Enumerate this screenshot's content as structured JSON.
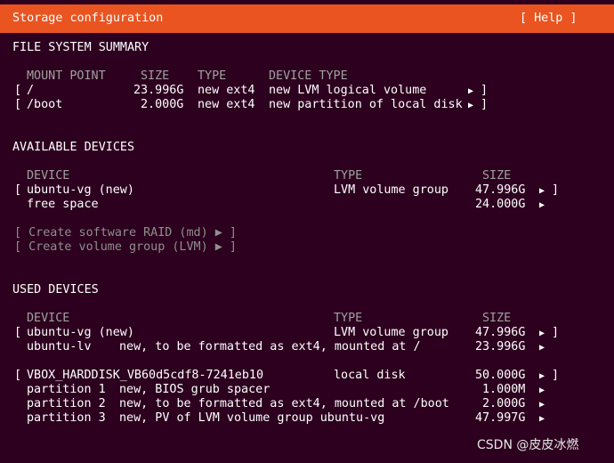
{
  "header": {
    "title": "Storage configuration",
    "help_button": "[ Help ]"
  },
  "fs_summary": {
    "heading": "FILE SYSTEM SUMMARY",
    "columns": [
      "MOUNT POINT",
      "SIZE",
      "TYPE",
      "DEVICE TYPE"
    ],
    "rows": [
      {
        "bracket_open": "[",
        "mount": "/",
        "size": "23.996G",
        "type": "new ext4",
        "device_type": "new LVM logical volume",
        "arrow": "▶",
        "bracket_close": "]"
      },
      {
        "bracket_open": "[",
        "mount": "/boot",
        "size": "2.000G",
        "type": "new ext4",
        "device_type": "new partition of local disk",
        "arrow": "▶",
        "bracket_close": "]"
      }
    ]
  },
  "available": {
    "heading": "AVAILABLE DEVICES",
    "columns": [
      "DEVICE",
      "TYPE",
      "SIZE"
    ],
    "rows": [
      {
        "bracket_open": "[",
        "device": "ubuntu-vg (new)",
        "type": "LVM volume group",
        "size": "47.996G",
        "arrow": "▶",
        "bracket_close": "]"
      },
      {
        "device": "free space",
        "size": "24.000G",
        "arrow": "▶"
      }
    ],
    "actions": [
      {
        "label": "[ Create software RAID (md) ▶ ]"
      },
      {
        "label": "[ Create volume group (LVM) ▶ ]"
      }
    ]
  },
  "used": {
    "heading": "USED DEVICES",
    "columns": [
      "DEVICE",
      "TYPE",
      "SIZE"
    ],
    "rows": [
      {
        "bracket_open": "[",
        "device": "ubuntu-vg (new)",
        "type": "LVM volume group",
        "size": "47.996G",
        "arrow": "▶",
        "bracket_close": "]"
      },
      {
        "device": "ubuntu-lv",
        "desc": "new, to be formatted as ext4, mounted at /",
        "size": "23.996G",
        "arrow": "▶"
      },
      {
        "bracket_open": "[",
        "device": "VBOX_HARDDISK_VB60d5cdf8-7241eb10",
        "type": "local disk",
        "size": "50.000G",
        "arrow": "▶",
        "bracket_close": "]"
      },
      {
        "device": "partition 1",
        "desc": "new, BIOS grub spacer",
        "size": "1.000M",
        "arrow": "▶"
      },
      {
        "device": "partition 2",
        "desc": "new, to be formatted as ext4, mounted at /boot",
        "size": "2.000G",
        "arrow": "▶"
      },
      {
        "device": "partition 3",
        "desc": "new, PV of LVM volume group ubuntu-vg",
        "size": "47.997G",
        "arrow": "▶"
      }
    ]
  },
  "watermark": "CSDN @皮皮冰燃",
  "colors": {
    "background": "#2c001e",
    "accent": "#e95420",
    "text": "#ffffff",
    "dim": "#a0a0a0"
  }
}
